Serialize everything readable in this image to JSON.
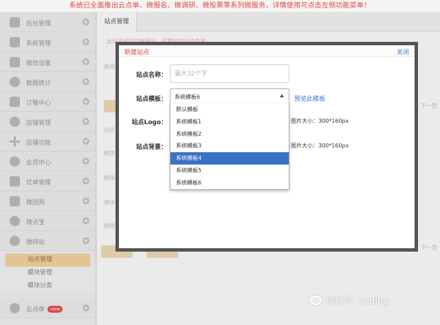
{
  "banner": {
    "text": "系统已全面推出云点单、微报名、微调研、微投票等系列微服务，详情使用可点击左侧功能菜单！"
  },
  "sidebar": {
    "items": [
      {
        "label": "后台管理",
        "icon": "home-icon"
      },
      {
        "label": "系统管理",
        "icon": "system-icon"
      },
      {
        "label": "微信设置",
        "icon": "mail-icon"
      },
      {
        "label": "数据统计",
        "icon": "chart-icon"
      },
      {
        "label": "订餐中心",
        "icon": "order-icon"
      },
      {
        "label": "店铺管理",
        "icon": "store-icon"
      },
      {
        "label": "店铺功能",
        "icon": "plus-icon"
      },
      {
        "label": "会员中心",
        "icon": "member-icon"
      },
      {
        "label": "优单管理",
        "icon": "list-icon"
      },
      {
        "label": "微团购",
        "icon": "group-icon"
      },
      {
        "label": "微点宝",
        "icon": "gem-icon"
      },
      {
        "label": "微网站",
        "icon": "globe-icon"
      }
    ],
    "sub_items": [
      {
        "label": "站点管理",
        "active": true
      },
      {
        "label": "模块管理",
        "active": false
      },
      {
        "label": "模块分类",
        "active": false
      }
    ],
    "bottom_item": {
      "label": "云点单",
      "badge": "new"
    }
  },
  "content": {
    "tab": "站点管理",
    "notice": "此处添加您的微网站，设置您的站点信息",
    "next_label": "下一页",
    "bg_labels": [
      "微网",
      "站点",
      "模块",
      "模块",
      "模块",
      "微网"
    ]
  },
  "modal": {
    "title": "新建站点",
    "close": "关闭",
    "name_label": "站点名称：",
    "name_placeholder": "最大32个字",
    "template_label": "站点模板：",
    "template_selected": "系统模板6",
    "preview_link": "预览此模板",
    "logo_label": "站点Logo：",
    "logo_hint": "图片大小：300*160px",
    "bg_label": "站点背景：",
    "bg_hint": "图片大小：300*160px",
    "options": [
      "默认模板",
      "系统模板1",
      "系统模板2",
      "系统模板3",
      "系统模板4",
      "系统模板5",
      "系统模板6"
    ],
    "highlighted_option": "系统模板4"
  },
  "watermark": {
    "text": "微信号: veding"
  }
}
